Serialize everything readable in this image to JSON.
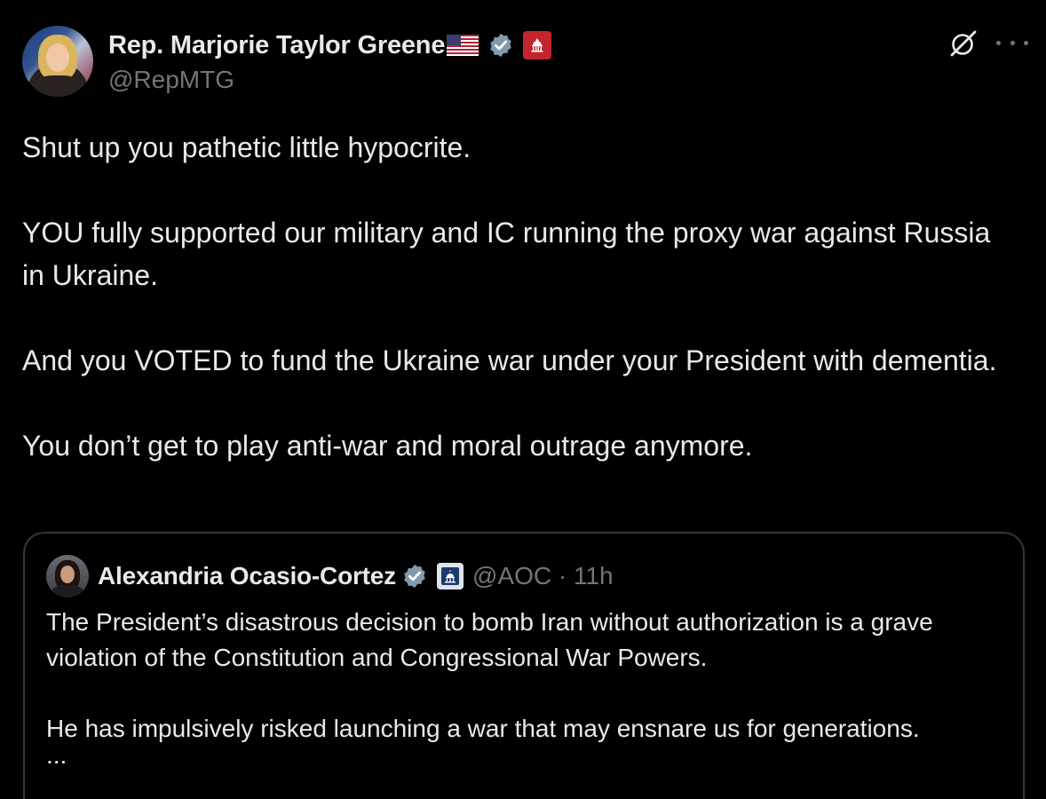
{
  "author": {
    "display_name": "Rep. Marjorie Taylor Greene",
    "handle": "@RepMTG",
    "flag_icon": "us-flag-icon",
    "verified_icon": "verified-badge-icon",
    "affiliation_icon": "gop-badge-icon"
  },
  "actions": {
    "grok_icon": "grok-icon",
    "more_icon": "more-options-icon"
  },
  "tweet": {
    "paragraphs": [
      "Shut up you pathetic little hypocrite.",
      "YOU fully supported our military and IC running the proxy war against Russia in Ukraine.",
      "And you VOTED to fund the Ukraine war under your President with dementia.",
      "You don’t get to play anti-war and moral outrage anymore."
    ]
  },
  "quoted_tweet": {
    "display_name": "Alexandria Ocasio-Cortez",
    "meta": "@AOC · 11h",
    "verified_icon": "verified-badge-icon",
    "affiliation_icon": "capitol-badge-icon",
    "paragraphs": [
      "The President’s disastrous decision to bomb Iran without authorization is a grave violation of the Constitution and Congressional War Powers.",
      "He has impulsively risked launching a war that may ensnare us for generations."
    ],
    "truncation": "..."
  },
  "colors": {
    "background": "#000000",
    "text_primary": "#e7e9ea",
    "text_secondary": "#71767b",
    "border": "#333639",
    "verified_gray": "#829aab",
    "gop_red": "#c4242e"
  }
}
